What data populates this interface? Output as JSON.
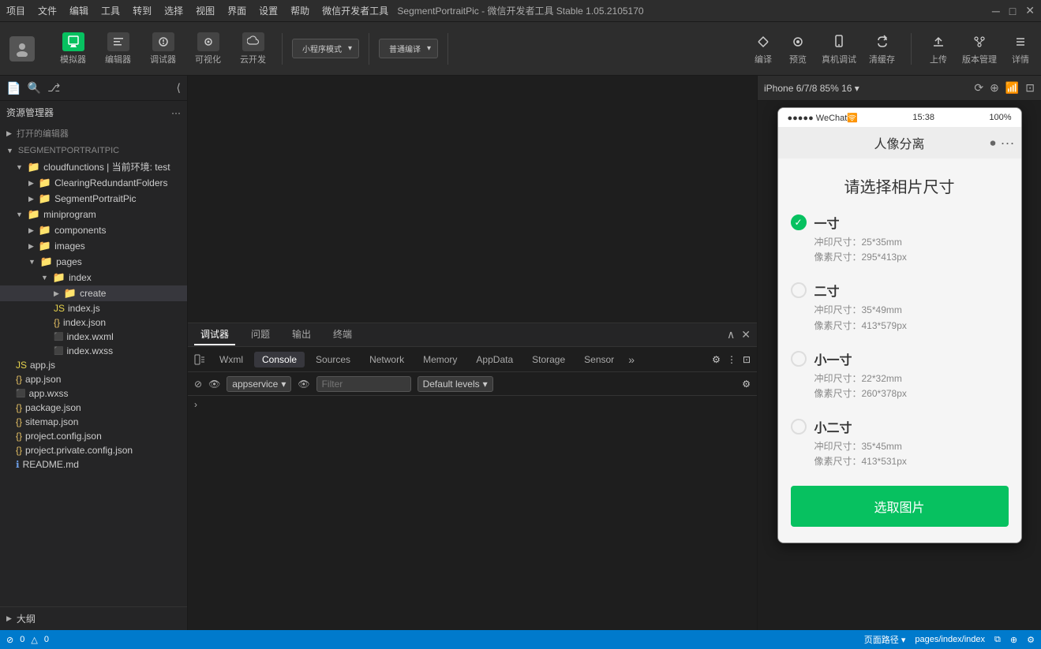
{
  "titlebar": {
    "menu_items": [
      "项目",
      "文件",
      "编辑",
      "工具",
      "转到",
      "选择",
      "视图",
      "界面",
      "设置",
      "帮助",
      "微信开发者工具"
    ],
    "title": "SegmentPortraitPic - 微信开发者工具 Stable 1.05.2105170",
    "controls": [
      "─",
      "□",
      "✕"
    ]
  },
  "toolbar": {
    "avatar_icon": "👤",
    "simulator_label": "模拟器",
    "editor_label": "编辑器",
    "debugger_label": "调试器",
    "visual_label": "可视化",
    "cloud_label": "云开发",
    "mode_label": "小程序模式",
    "compile_label": "普通编译",
    "translate_label": "编译",
    "preview_label": "预览",
    "real_label": "真机调试",
    "clear_label": "清缓存",
    "upload_label": "上传",
    "version_label": "版本管理",
    "detail_label": "详情"
  },
  "sidebar": {
    "header": "资源管理器",
    "header_more": "···",
    "open_editors": "打开的编辑器",
    "project_name": "SEGMENTPORTRAITPIC",
    "items": [
      {
        "label": "cloudfunctions | 当前环境: test",
        "indent": 1,
        "type": "folder",
        "expanded": true
      },
      {
        "label": "ClearingRedundantFolders",
        "indent": 2,
        "type": "folder",
        "expanded": false
      },
      {
        "label": "SegmentPortraitPic",
        "indent": 2,
        "type": "folder",
        "expanded": false
      },
      {
        "label": "miniprogram",
        "indent": 1,
        "type": "folder",
        "expanded": true
      },
      {
        "label": "components",
        "indent": 2,
        "type": "folder",
        "expanded": false
      },
      {
        "label": "images",
        "indent": 2,
        "type": "folder",
        "expanded": false
      },
      {
        "label": "pages",
        "indent": 2,
        "type": "folder",
        "expanded": true
      },
      {
        "label": "index",
        "indent": 3,
        "type": "folder",
        "expanded": true
      },
      {
        "label": "create",
        "indent": 4,
        "type": "folder",
        "expanded": false,
        "active": true
      },
      {
        "label": "index.js",
        "indent": 4,
        "type": "js"
      },
      {
        "label": "index.json",
        "indent": 4,
        "type": "json"
      },
      {
        "label": "index.wxml",
        "indent": 4,
        "type": "wxml"
      },
      {
        "label": "index.wxss",
        "indent": 4,
        "type": "wxss"
      },
      {
        "label": "app.js",
        "indent": 1,
        "type": "js"
      },
      {
        "label": "app.json",
        "indent": 1,
        "type": "json"
      },
      {
        "label": "app.wxss",
        "indent": 1,
        "type": "wxss"
      },
      {
        "label": "package.json",
        "indent": 1,
        "type": "json"
      },
      {
        "label": "sitemap.json",
        "indent": 1,
        "type": "json"
      },
      {
        "label": "project.config.json",
        "indent": 1,
        "type": "json"
      },
      {
        "label": "project.private.config.json",
        "indent": 1,
        "type": "json"
      },
      {
        "label": "README.md",
        "indent": 1,
        "type": "md"
      }
    ],
    "outline": "大纲",
    "error_count": "0",
    "warning_count": "0"
  },
  "debug_panel": {
    "tabs": [
      "调试器",
      "问题",
      "输出",
      "终端"
    ],
    "active_tab": "调试器",
    "subtabs": [
      "Wxml",
      "Console",
      "Sources",
      "Network",
      "Memory",
      "AppData",
      "Storage",
      "Sensor"
    ],
    "active_subtab": "Console",
    "context_selector": "appservice",
    "filter_placeholder": "Filter",
    "level_selector": "Default levels",
    "caret_symbol": "›"
  },
  "preview": {
    "device_label": "iPhone 6/7/8 85% 16 ▾",
    "phone": {
      "signal": "●●●●●",
      "carrier": "WeChat",
      "wifi": "WiFi",
      "time": "15:38",
      "battery": "100%",
      "wechat_title": "人像分离",
      "select_title": "请选择相片尺寸",
      "options": [
        {
          "name": "一寸",
          "print_size": "冲印尺寸：25*35mm",
          "pixel_size": "像素尺寸：295*413px",
          "checked": true
        },
        {
          "name": "二寸",
          "print_size": "冲印尺寸：35*49mm",
          "pixel_size": "像素尺寸：413*579px",
          "checked": false
        },
        {
          "name": "小一寸",
          "print_size": "冲印尺寸：22*32mm",
          "pixel_size": "像素尺寸：260*378px",
          "checked": false
        },
        {
          "name": "小二寸",
          "print_size": "冲印尺寸：35*45mm",
          "pixel_size": "像素尺寸：413*531px",
          "checked": false
        }
      ],
      "button_label": "选取图片"
    }
  },
  "statusbar": {
    "error_icon": "⊘",
    "error_count": "0",
    "warning_icon": "△",
    "warning_count": "0",
    "page_path_label": "页面路径 ▾",
    "page_path": "pages/index/index",
    "zoom_icon": "⊕",
    "settings_icon": "⚙"
  }
}
